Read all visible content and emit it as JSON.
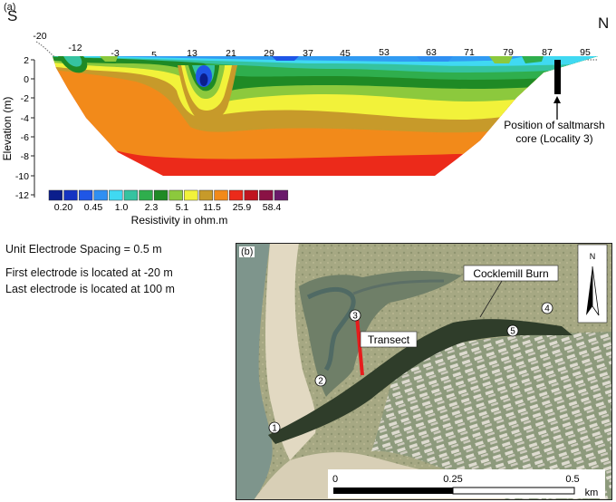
{
  "panel_a": {
    "label": "(a)",
    "dir_left": "S",
    "dir_right": "N",
    "ylabel": "Elevation (m)",
    "xtick_labels": [
      "-20",
      "-12",
      "-3",
      "5",
      "13",
      "21",
      "29",
      "37",
      "45",
      "53",
      "63",
      "71",
      "79",
      "87",
      "95"
    ],
    "ytick_labels": [
      "2",
      "0",
      "-2",
      "-4",
      "-6",
      "-8",
      "-10",
      "-12"
    ],
    "core_annotation": [
      "Position of saltmarsh",
      "core (Locality 3)"
    ],
    "legend": {
      "title": "Resistivity in ohm.m",
      "labels": [
        "0.20",
        "0.45",
        "1.0",
        "2.3",
        "5.1",
        "11.5",
        "25.9",
        "58.4"
      ],
      "colors": [
        "#0b1e8c",
        "#1533c2",
        "#1f56e6",
        "#2f8ff2",
        "#40d9f2",
        "#35c3a0",
        "#2fae4d",
        "#1f8a25",
        "#8cc93d",
        "#f2f23a",
        "#c79a2a",
        "#f28a1a",
        "#ec2a1a",
        "#c01620",
        "#8a1245",
        "#6a1a6a"
      ]
    }
  },
  "info": {
    "spacing": "Unit Electrode Spacing = 0.5 m",
    "first": "First electrode is located at -20 m",
    "last": "Last electrode is located at 100 m"
  },
  "panel_b": {
    "label": "(b)",
    "north": "N",
    "cocklemill": "Cocklemill Burn",
    "transect": "Transect",
    "localities": [
      "1",
      "2",
      "3",
      "4",
      "5"
    ],
    "scale_labels": [
      "0",
      "0.25",
      "0.5"
    ],
    "scale_unit": "km"
  }
}
